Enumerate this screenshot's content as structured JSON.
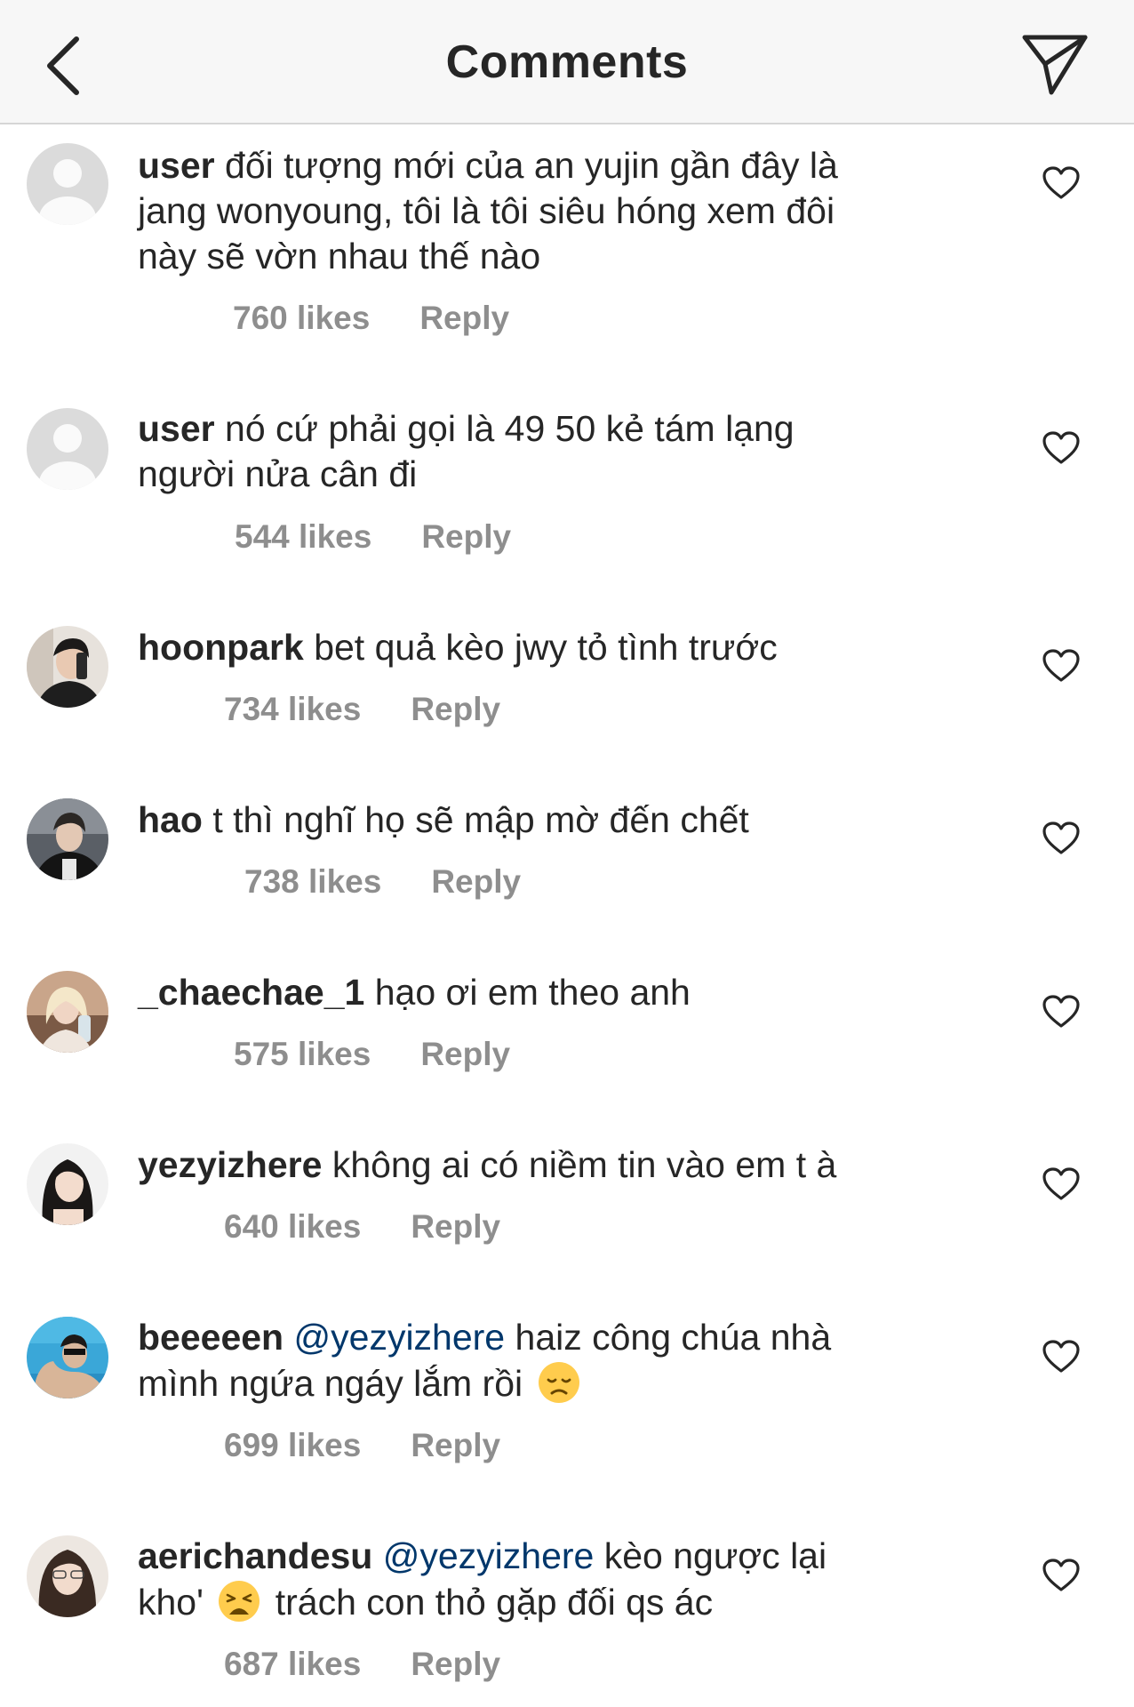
{
  "header": {
    "title": "Comments",
    "back_icon": "chevron-left-icon",
    "send_icon": "paper-plane-icon"
  },
  "colors": {
    "text": "#262626",
    "muted": "#8e8e8e",
    "mention": "#00376b",
    "header_bg": "#f7f7f7"
  },
  "comments": [
    {
      "username": "user",
      "text": "đối tượng mới của an yujin gần đây là",
      "text_2": "jang wonyoung, tôi là tôi siêu hóng xem đôi",
      "text_3": "này sẽ vờn nhau thế nào",
      "likes": "760 likes",
      "reply": "Reply",
      "avatar": "default-avatar"
    },
    {
      "username": "user",
      "text": "nó cứ phải gọi là 49 50 kẻ tám lạng",
      "text_2": "người nửa cân đi",
      "likes": "544 likes",
      "reply": "Reply",
      "avatar": "default-avatar"
    },
    {
      "username": "hoonpark",
      "text": "bet quả kèo jwy tỏ tình trước",
      "likes": "734 likes",
      "reply": "Reply",
      "avatar": "photo-avatar"
    },
    {
      "username": "hao",
      "text": "t thì nghĩ họ sẽ mập mờ đến chết",
      "likes": "738 likes",
      "reply": "Reply",
      "avatar": "photo-avatar"
    },
    {
      "username": "_chaechae_1",
      "text": "hạo ơi em theo anh",
      "likes": "575 likes",
      "reply": "Reply",
      "avatar": "photo-avatar"
    },
    {
      "username": "yezyizhere",
      "text": "không ai có niềm tin vào em t à",
      "likes": "640 likes",
      "reply": "Reply",
      "avatar": "photo-avatar"
    },
    {
      "username": "beeeeen",
      "mention": "@yezyizhere",
      "text": "haiz công chúa nhà",
      "text_2": "mình ngứa ngáy lắm rồi",
      "emoji": "disappointed-face",
      "likes": "699 likes",
      "reply": "Reply",
      "avatar": "photo-avatar"
    },
    {
      "username": "aerichandesu",
      "mention": "@yezyizhere",
      "text": "kèo ngược lại",
      "text_2a": "khoʹ",
      "text_2b": "trách con thỏ gặp đối qs ác",
      "emoji": "weary-face",
      "likes": "687 likes",
      "reply": "Reply",
      "avatar": "photo-avatar"
    }
  ]
}
